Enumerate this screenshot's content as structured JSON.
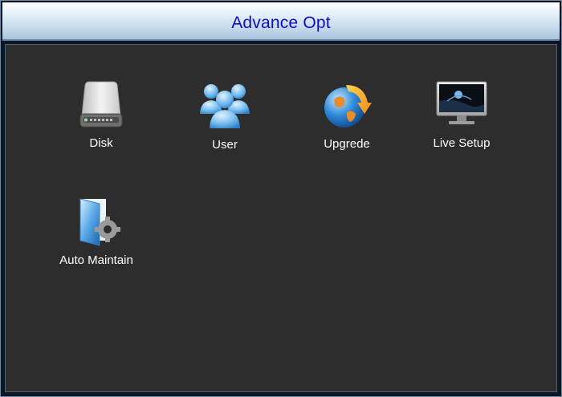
{
  "window": {
    "title": "Advance Opt"
  },
  "menu": {
    "items": [
      {
        "label": "Disk",
        "icon": "disk-drive-icon"
      },
      {
        "label": "User",
        "icon": "users-icon"
      },
      {
        "label": "Upgrede",
        "icon": "upgrade-globe-icon"
      },
      {
        "label": "Live Setup",
        "icon": "monitor-icon"
      },
      {
        "label": "Auto Maintain",
        "icon": "auto-maintain-icon"
      }
    ]
  },
  "colors": {
    "title_text": "#0d0dc8",
    "content_bg": "#2d2d2d",
    "label_text": "#ffffff"
  }
}
